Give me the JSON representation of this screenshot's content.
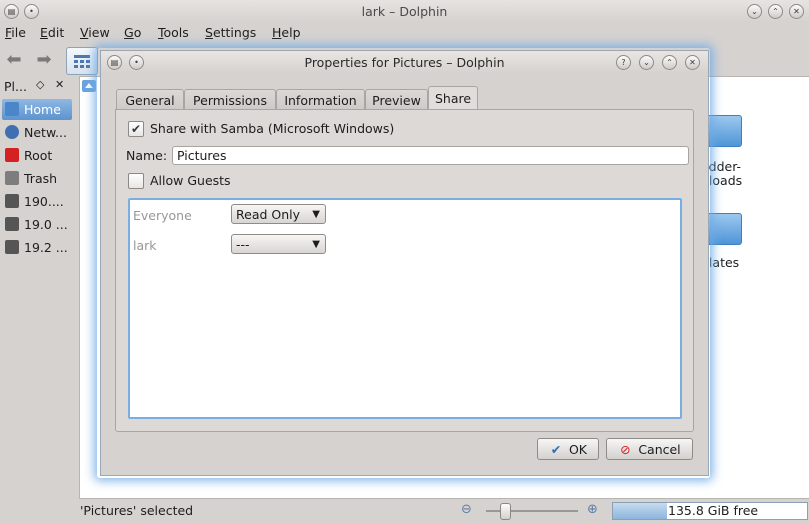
{
  "window": {
    "title": "lark – Dolphin"
  },
  "menubar": [
    "File",
    "Edit",
    "View",
    "Go",
    "Tools",
    "Settings",
    "Help"
  ],
  "places": {
    "title": "Pl...",
    "items": [
      {
        "label": "Home",
        "icon": "home-icon",
        "color": "#4a86c8"
      },
      {
        "label": "Netw...",
        "icon": "network-icon",
        "color": "#3f6fb0"
      },
      {
        "label": "Root",
        "icon": "folder-red-icon",
        "color": "#d42222"
      },
      {
        "label": "Trash",
        "icon": "trash-icon",
        "color": "#7d7d7d"
      },
      {
        "label": "190....",
        "icon": "drive-icon",
        "color": "#555555"
      },
      {
        "label": "19.0 ...",
        "icon": "drive-icon",
        "color": "#555555"
      },
      {
        "label": "19.2 ...",
        "icon": "drive-icon",
        "color": "#555555"
      }
    ]
  },
  "view": {
    "folders": [
      {
        "label1": "odder-",
        "label2": "nloads"
      },
      {
        "label1": "plates",
        "label2": ""
      }
    ]
  },
  "status": {
    "text": "'Pictures' selected",
    "free_space": "135.8 GiB free",
    "free_ratio": 0.28
  },
  "dialog": {
    "title": "Properties for Pictures – Dolphin",
    "tabs": [
      "General",
      "Permissions",
      "Information",
      "Preview",
      "Share"
    ],
    "active_tab": "Share",
    "share_with_samba": "Share with Samba (Microsoft Windows)",
    "share_checked": true,
    "name_label": "Name:",
    "name_value": "Pictures",
    "allow_guests": "Allow Guests",
    "allow_guests_checked": false,
    "users": [
      {
        "name": "Everyone",
        "permission": "Read Only"
      },
      {
        "name": "lark",
        "permission": "---"
      }
    ],
    "ok_label": "OK",
    "cancel_label": "Cancel"
  },
  "accent": "#7aaee3"
}
